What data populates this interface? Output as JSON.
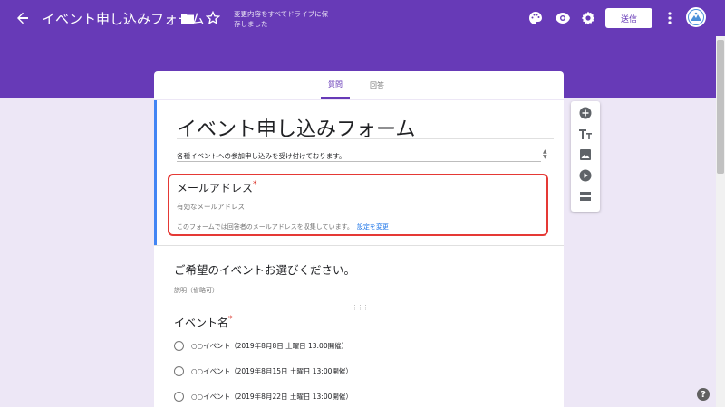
{
  "header": {
    "form_title": "イベント申し込みフォーム",
    "save_status": "変更内容をすべてドライブに保存しました",
    "send_label": "送信",
    "icons": [
      "arrow-back-icon",
      "folder-icon",
      "star-icon",
      "palette-icon",
      "eye-icon",
      "gear-icon",
      "more-vert-icon",
      "avatar"
    ],
    "bg_color": "#673ab7"
  },
  "tabs": [
    {
      "label": "質問",
      "active": true
    },
    {
      "label": "回答",
      "active": false
    }
  ],
  "form": {
    "title": "イベント申し込みフォーム",
    "description": "各種イベントへの参加申し込みを受け付けております。",
    "email_question": {
      "label": "メールアドレス",
      "required_mark": "*",
      "placeholder": "有効なメールアドレス",
      "note": "このフォームでは回答者のメールアドレスを収集しています。",
      "link_label": "設定を変更"
    }
  },
  "section": {
    "title": "ご希望のイベントお選びください。",
    "description_placeholder": "説明（省略可）",
    "question": {
      "label": "イベント名",
      "required_mark": "*",
      "options": [
        "○○イベント（2019年8月8日 土曜日 13:00開催）",
        "○○イベント（2019年8月15日 土曜日 13:00開催）",
        "○○イベント（2019年8月22日 土曜日 13:00開催）"
      ]
    }
  },
  "toolbar": {
    "tools": [
      "add-question-icon",
      "title-text-icon",
      "image-icon",
      "video-icon",
      "section-icon"
    ]
  },
  "colors": {
    "accent": "#673ab7",
    "background": "#ede7f6",
    "highlight": "#e53935",
    "link": "#1a73e8",
    "focus_bar": "#4285f4",
    "required": "#d93025"
  }
}
